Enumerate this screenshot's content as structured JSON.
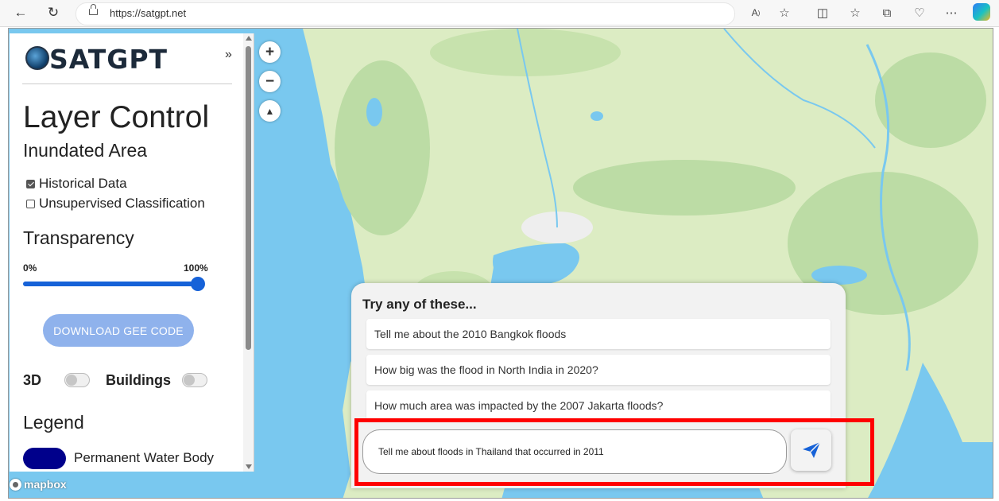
{
  "browser": {
    "url": "https://satgpt.net",
    "icons": [
      "back-arrow-icon",
      "refresh-icon",
      "lock-icon",
      "read-aloud-icon",
      "favorite-star-icon",
      "split-screen-icon",
      "favorites-icon",
      "collections-icon",
      "browser-essentials-icon",
      "more-icon",
      "copilot-icon"
    ]
  },
  "sidebar": {
    "logo_text": "SATGPT",
    "collapse_label": "»",
    "title": "Layer Control",
    "section_inundated": "Inundated Area",
    "checkboxes": [
      {
        "label": "Historical Data",
        "checked": true
      },
      {
        "label": "Unsupervised Classification",
        "checked": false
      }
    ],
    "section_transparency": "Transparency",
    "slider": {
      "min_label": "0%",
      "max_label": "100%",
      "value": 1.0
    },
    "download_button": "DOWNLOAD GEE CODE",
    "toggles": [
      {
        "label": "3D",
        "on": false
      },
      {
        "label": "Buildings",
        "on": false
      }
    ],
    "section_legend": "Legend",
    "legend": [
      {
        "label": "Permanent Water Body",
        "color": "#00008b"
      }
    ]
  },
  "map_controls": {
    "zoom_in": "+",
    "zoom_out": "−",
    "compass": "▲"
  },
  "attribution": "mapbox",
  "chat": {
    "heading": "Try any of these...",
    "suggestions": [
      "Tell me about the 2010 Bangkok floods",
      "How big was the flood in North India in 2020?",
      "How much area was impacted by the 2007 Jakarta floods?"
    ],
    "input_value": "Tell me about floods in Thailand that occurred in 2011",
    "send_icon": "paper-plane-icon"
  },
  "colors": {
    "accent": "#1662d8",
    "button_disabled": "#8fb2ec",
    "highlight": "#ff0000",
    "water": "#79c8ef",
    "land": "#dcecc3"
  }
}
